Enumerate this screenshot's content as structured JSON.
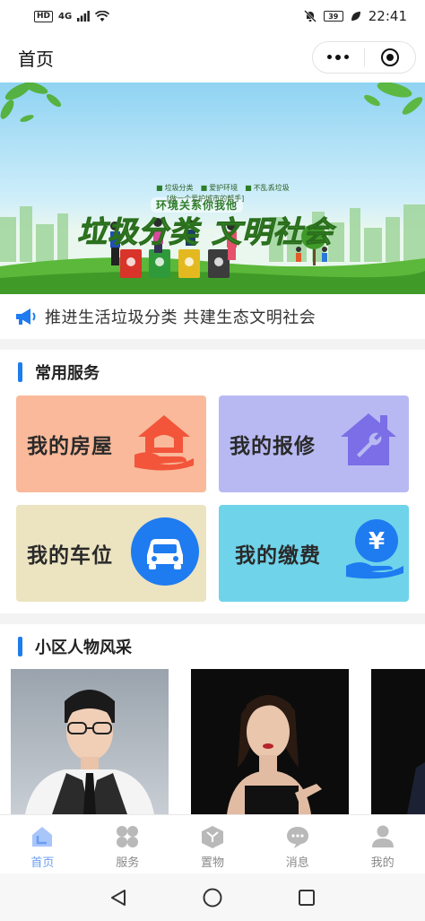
{
  "status_bar": {
    "network_badge": "HD",
    "signal_label": "4G",
    "battery": "39",
    "time": "22:41"
  },
  "nav": {
    "title": "首页"
  },
  "banner": {
    "slogan": "环境关系你我他",
    "title_part1": "垃圾分类",
    "title_part2": "文明社会",
    "items": [
      "垃圾分类",
      "爱护环境",
      "不乱丢垃圾"
    ],
    "help": "[做一个爱护城市的帮手]"
  },
  "notice": {
    "text": "推进生活垃圾分类 共建生态文明社会",
    "icon": "megaphone-icon"
  },
  "services": {
    "title": "常用服务",
    "items": [
      {
        "label": "我的房屋",
        "bg": "#f9b99a",
        "icon": "house-hand-icon",
        "icon_color": "#f2553a"
      },
      {
        "label": "我的报修",
        "bg": "#b8b9f3",
        "icon": "house-wrench-icon",
        "icon_color": "#7b6ee6"
      },
      {
        "label": "我的车位",
        "bg": "#ece3c0",
        "icon": "car-icon",
        "icon_color": "#1e7bf0"
      },
      {
        "label": "我的缴费",
        "bg": "#6fd3ea",
        "icon": "yuan-hand-icon",
        "icon_color": "#1e7bf0"
      }
    ]
  },
  "people": {
    "title": "小区人物风采"
  },
  "tabbar": {
    "items": [
      {
        "label": "首页",
        "icon": "home-icon",
        "active": true
      },
      {
        "label": "服务",
        "icon": "grid-icon",
        "active": false
      },
      {
        "label": "置物",
        "icon": "box-icon",
        "active": false
      },
      {
        "label": "消息",
        "icon": "chat-icon",
        "active": false
      },
      {
        "label": "我的",
        "icon": "user-icon",
        "active": false
      }
    ]
  },
  "colors": {
    "accent": "#1e7bf0",
    "tab_active": "#6a9cf5",
    "tab_inactive": "#b9b9b9"
  }
}
